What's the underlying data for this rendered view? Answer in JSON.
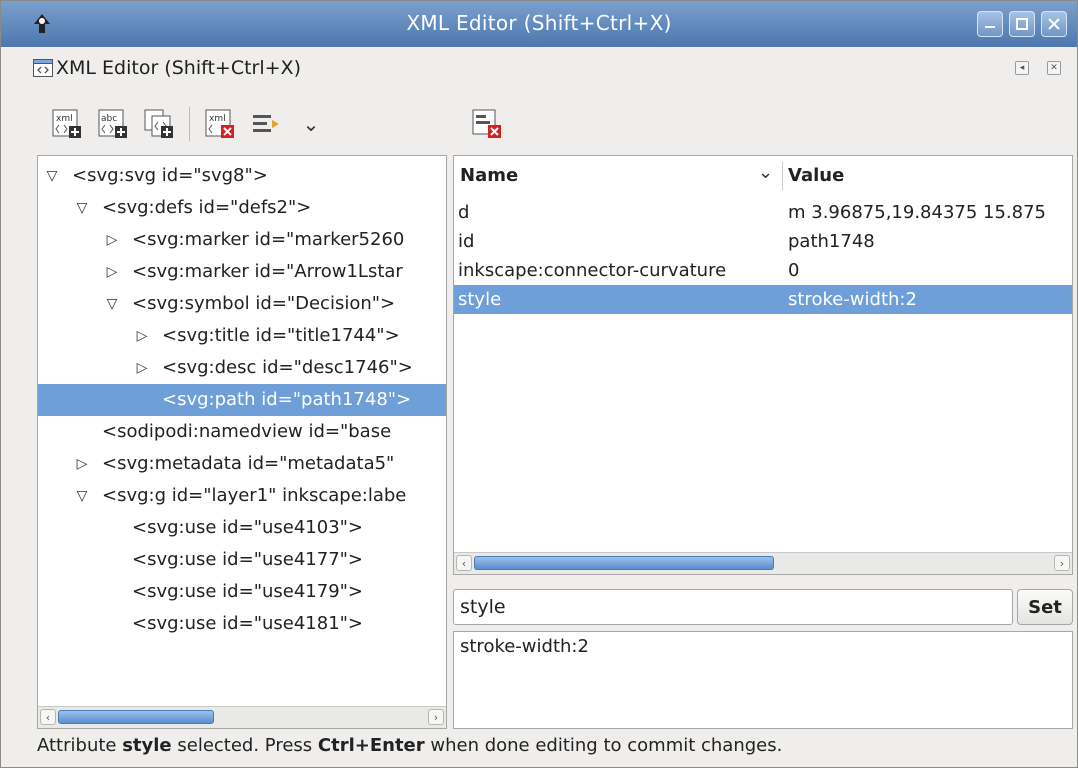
{
  "window": {
    "title": "XML Editor (Shift+Ctrl+X)"
  },
  "dock": {
    "title": "XML Editor (Shift+Ctrl+X)"
  },
  "toolbar": {
    "node_buttons": [
      {
        "name": "new-element-node-icon"
      },
      {
        "name": "new-text-node-icon"
      },
      {
        "name": "duplicate-node-icon"
      },
      {
        "name": "delete-node-icon"
      },
      {
        "name": "indent-node-icon"
      }
    ],
    "attr_buttons": [
      {
        "name": "delete-attribute-icon"
      }
    ]
  },
  "tree": {
    "nodes": [
      {
        "label": "<svg:svg id=\"svg8\">",
        "expander": "▽"
      },
      {
        "label": "<svg:defs id=\"defs2\">",
        "expander": "▽"
      },
      {
        "label": "<svg:marker id=\"marker5260",
        "expander": "▷"
      },
      {
        "label": "<svg:marker id=\"Arrow1Lstar",
        "expander": "▷"
      },
      {
        "label": "<svg:symbol id=\"Decision\">",
        "expander": "▽"
      },
      {
        "label": "<svg:title id=\"title1744\">",
        "expander": "▷"
      },
      {
        "label": "<svg:desc id=\"desc1746\">",
        "expander": "▷"
      },
      {
        "label": "<svg:path id=\"path1748\">",
        "expander": ""
      },
      {
        "label": "<sodipodi:namedview id=\"base",
        "expander": ""
      },
      {
        "label": "<svg:metadata id=\"metadata5\"",
        "expander": "▷"
      },
      {
        "label": "<svg:g id=\"layer1\" inkscape:labe",
        "expander": "▽"
      },
      {
        "label": "<svg:use id=\"use4103\">",
        "expander": ""
      },
      {
        "label": "<svg:use id=\"use4177\">",
        "expander": ""
      },
      {
        "label": "<svg:use id=\"use4179\">",
        "expander": ""
      },
      {
        "label": "<svg:use id=\"use4181\">",
        "expander": ""
      }
    ]
  },
  "attributes": {
    "header_name": "Name",
    "header_value": "Value",
    "rows": [
      {
        "name": "d",
        "value": "m 3.96875,19.84375 15.875"
      },
      {
        "name": "id",
        "value": "path1748"
      },
      {
        "name": "inkscape:connector-curvature",
        "value": "0"
      },
      {
        "name": "style",
        "value": "stroke-width:2"
      }
    ]
  },
  "editor": {
    "attr_name": "style",
    "set_label": "Set",
    "attr_value": "stroke-width:2"
  },
  "status": {
    "part1": "Attribute ",
    "bold1": "style",
    "part2": " selected. Press ",
    "bold2": "Ctrl+Enter",
    "part3": " when done editing to commit changes."
  },
  "colors": {
    "selection": "#6f9fd8",
    "titlebar": "#5a82b6"
  }
}
